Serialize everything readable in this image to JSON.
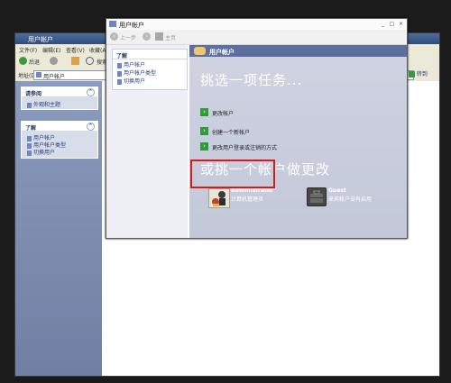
{
  "back_window": {
    "title": "用户帐户",
    "menu": [
      "文件(F)",
      "编辑(E)",
      "查看(V)",
      "收藏(A)"
    ],
    "back_label": "后退",
    "search_label": "搜索",
    "address_label": "地址(D)",
    "address_value": "用户帐户",
    "go_label": "转到",
    "see_also": {
      "heading": "请参阅",
      "links": [
        "外观和主题"
      ]
    },
    "learn": {
      "heading": "了解",
      "links": [
        "用户帐户",
        "用户帐户类型",
        "切换用户"
      ]
    }
  },
  "front_window": {
    "title": "用户帐户",
    "nav": {
      "back": "上一步",
      "home": "主页"
    },
    "learn": {
      "heading": "了解",
      "links": [
        "用户帐户",
        "用户帐户类型",
        "切换用户"
      ]
    },
    "main_title": "用户帐户",
    "pick_task_heading": "挑选一项任务...",
    "tasks": [
      "更改帐户",
      "创建一个新帐户",
      "更改用户登录或注销的方式"
    ],
    "pick_account_heading": "或挑一个帐户做更改",
    "accounts": [
      {
        "name": "Administrator",
        "detail": "计算机管理员"
      },
      {
        "name": "Guest",
        "detail": "来宾帐户没有启用"
      }
    ]
  },
  "colors": {
    "highlight": "#d61b1b",
    "header_bar": "#5d6f9d",
    "task_arrow": "#2f9b3b"
  }
}
